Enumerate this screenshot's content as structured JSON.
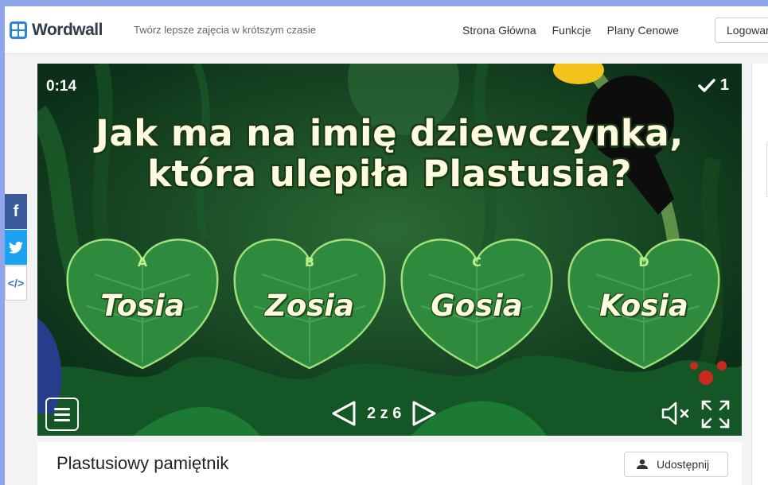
{
  "header": {
    "logo_text": "Wordwall",
    "tagline": "Twórz lepsze zajęcia w krótszym czasie",
    "nav": [
      "Strona Główna",
      "Funkcje",
      "Plany Cenowe"
    ],
    "login_label": "Logowanie"
  },
  "game": {
    "timer": "0:14",
    "score": "1",
    "question_line1": "Jak ma na imię dziewczynka,",
    "question_line2": "która ulepiła Plastusia?",
    "answers": [
      {
        "letter": "A",
        "text": "Tosia"
      },
      {
        "letter": "B",
        "text": "Zosia"
      },
      {
        "letter": "C",
        "text": "Gosia"
      },
      {
        "letter": "D",
        "text": "Kosia"
      }
    ],
    "page_indicator": "2 z 6"
  },
  "share_bar": {
    "facebook_glyph": "f",
    "embed_glyph": "</>"
  },
  "activity": {
    "title": "Plastusiowy pamiętnik",
    "share_label": "Udostępnij"
  },
  "colors": {
    "leaf": "#2e8a3c",
    "jungle_dark": "#0e3a1d",
    "page_bg": "#8fa6ea",
    "facebook": "#3b5a9a",
    "twitter": "#1da1f2"
  }
}
